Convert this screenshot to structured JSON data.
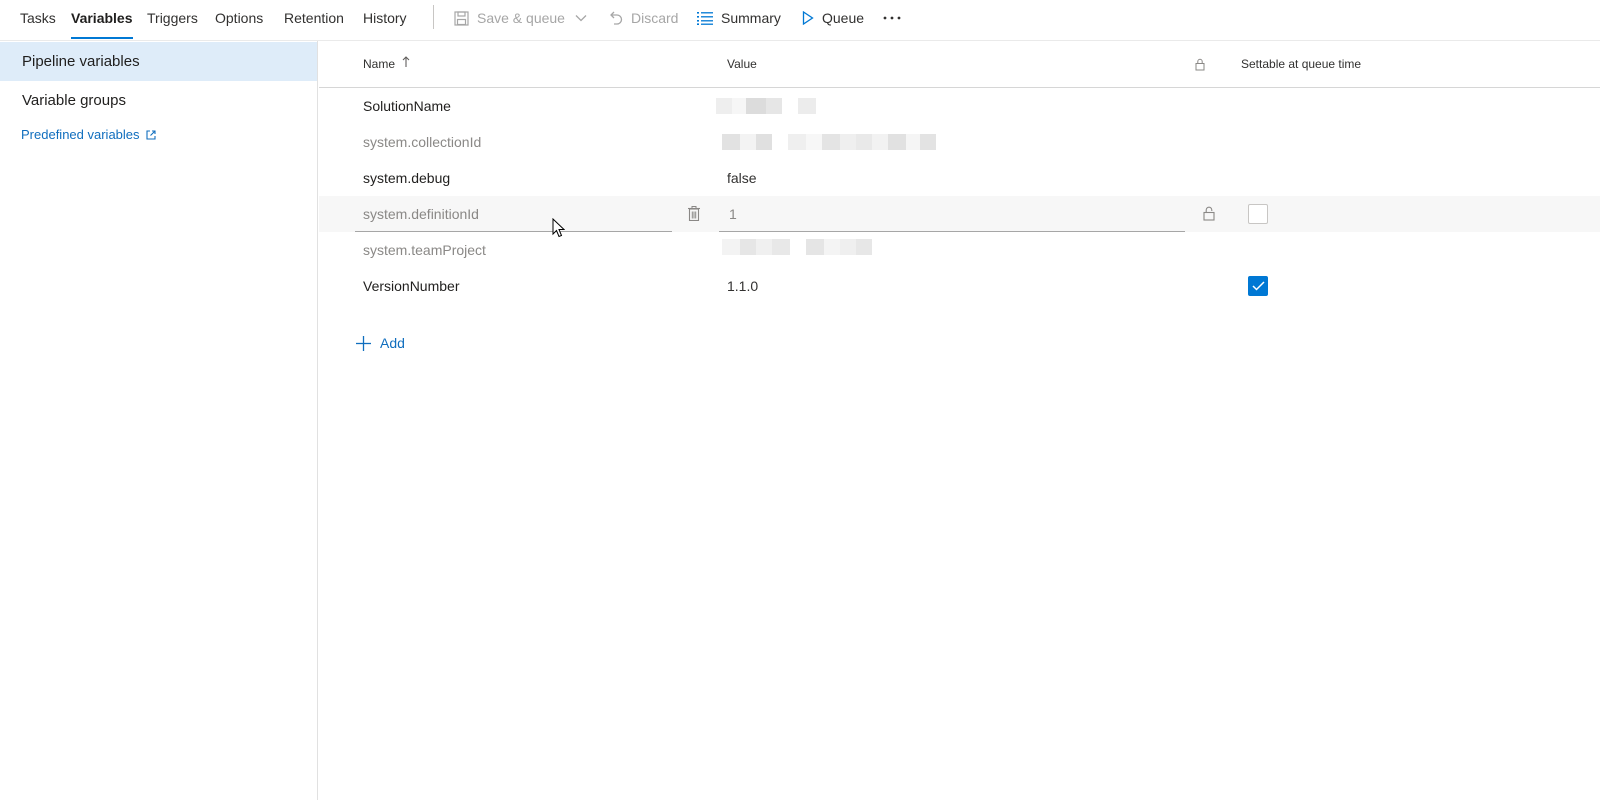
{
  "tabs": [
    {
      "label": "Tasks",
      "active": false
    },
    {
      "label": "Variables",
      "active": true
    },
    {
      "label": "Triggers",
      "active": false
    },
    {
      "label": "Options",
      "active": false
    },
    {
      "label": "Retention",
      "active": false
    },
    {
      "label": "History",
      "active": false
    }
  ],
  "toolbar": {
    "save_queue_label": "Save & queue",
    "save_queue_disabled": true,
    "discard_label": "Discard",
    "discard_disabled": true,
    "summary_label": "Summary",
    "queue_label": "Queue",
    "more_icon": "ellipsis-icon"
  },
  "sidebar": {
    "items": [
      {
        "label": "Pipeline variables",
        "selected": true
      },
      {
        "label": "Variable groups",
        "selected": false
      }
    ],
    "link_label": "Predefined variables",
    "link_icon": "external-link-icon"
  },
  "grid": {
    "headers": {
      "name": "Name",
      "name_sort_icon": "sort-ascending-icon",
      "value": "Value",
      "lock_icon": "lock-icon",
      "settable": "Settable at queue time"
    },
    "rows": [
      {
        "name": "SolutionName",
        "value": "",
        "value_masked": true,
        "system": false,
        "settable": null
      },
      {
        "name": "system.collectionId",
        "value": "",
        "value_masked": true,
        "system": true,
        "settable": null
      },
      {
        "name": "system.debug",
        "value": "false",
        "value_masked": false,
        "system": false,
        "settable": null
      },
      {
        "name": "system.definitionId",
        "value": "1",
        "value_masked": false,
        "system": true,
        "settable": false,
        "hovered": true
      },
      {
        "name": "system.teamProject",
        "value": "",
        "value_masked": true,
        "system": true,
        "settable": null
      },
      {
        "name": "VersionNumber",
        "value": "1.1.0",
        "value_masked": false,
        "system": false,
        "settable": true
      }
    ],
    "add_label": "Add"
  },
  "colors": {
    "accent": "#0078d4",
    "link": "#106ebe",
    "selected_nav": "#deecf9",
    "system_text": "#8a8886"
  }
}
